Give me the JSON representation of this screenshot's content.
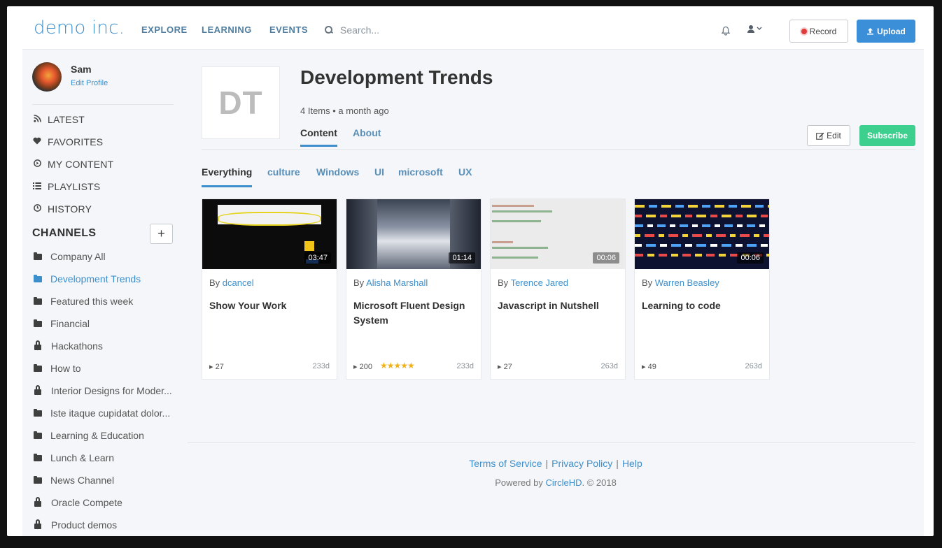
{
  "header": {
    "logo": "demo inc.",
    "nav": [
      "EXPLORE",
      "LEARNING",
      "EVENTS"
    ],
    "search_placeholder": "Search...",
    "record_label": "Record",
    "upload_label": "Upload"
  },
  "profile": {
    "name": "Sam",
    "edit_label": "Edit Profile"
  },
  "sidebar": {
    "items": [
      "LATEST",
      "FAVORITES",
      "MY CONTENT",
      "PLAYLISTS",
      "HISTORY"
    ],
    "channels_title": "CHANNELS",
    "add_label": "+",
    "channels": [
      {
        "label": "Company All",
        "locked": false
      },
      {
        "label": "Development Trends",
        "locked": false,
        "active": true
      },
      {
        "label": "Featured this week",
        "locked": false
      },
      {
        "label": "Financial",
        "locked": false
      },
      {
        "label": "Hackathons",
        "locked": true
      },
      {
        "label": "How to",
        "locked": false
      },
      {
        "label": "Interior Designs for Moder...",
        "locked": true
      },
      {
        "label": "Iste itaque cupidatat dolor...",
        "locked": false
      },
      {
        "label": "Learning & Education",
        "locked": false
      },
      {
        "label": "Lunch & Learn",
        "locked": false
      },
      {
        "label": "News Channel",
        "locked": false
      },
      {
        "label": "Oracle Compete",
        "locked": true
      },
      {
        "label": "Product demos",
        "locked": true
      }
    ]
  },
  "channel": {
    "initials": "DT",
    "title": "Development Trends",
    "meta": "4 Items • a month ago",
    "tabs": [
      "Content",
      "About"
    ],
    "edit_label": "Edit",
    "subscribe_label": "Subscribe",
    "filters": [
      "Everything",
      "culture",
      "Windows",
      "UI",
      "microsoft",
      "UX"
    ]
  },
  "cards": [
    {
      "by": "By",
      "author": "dcancel",
      "title": "Show Your Work",
      "duration": "03:47",
      "views": "27",
      "age": "233d",
      "rating": ""
    },
    {
      "by": "By",
      "author": "Alisha Marshall",
      "title": "Microsoft Fluent Design System",
      "duration": "01:14",
      "views": "200",
      "age": "233d",
      "rating": "★★★★★"
    },
    {
      "by": "By",
      "author": "Terence Jared",
      "title": "Javascript in Nutshell",
      "duration": "00:06",
      "views": "27",
      "age": "263d",
      "rating": ""
    },
    {
      "by": "By",
      "author": "Warren Beasley",
      "title": "Learning to code",
      "duration": "00:06",
      "views": "49",
      "age": "263d",
      "rating": ""
    }
  ],
  "footer": {
    "links": [
      "Terms of Service",
      "Privacy Policy",
      "Help"
    ],
    "separator": "|",
    "powered_prefix": "Powered by",
    "powered_brand": "CircleHD",
    "powered_suffix": ". © 2018"
  },
  "colors": {
    "accent": "#3d8fcc",
    "subscribe": "#3ccf8e",
    "upload": "#3a8fd8",
    "record_dot": "#e03a3a"
  }
}
